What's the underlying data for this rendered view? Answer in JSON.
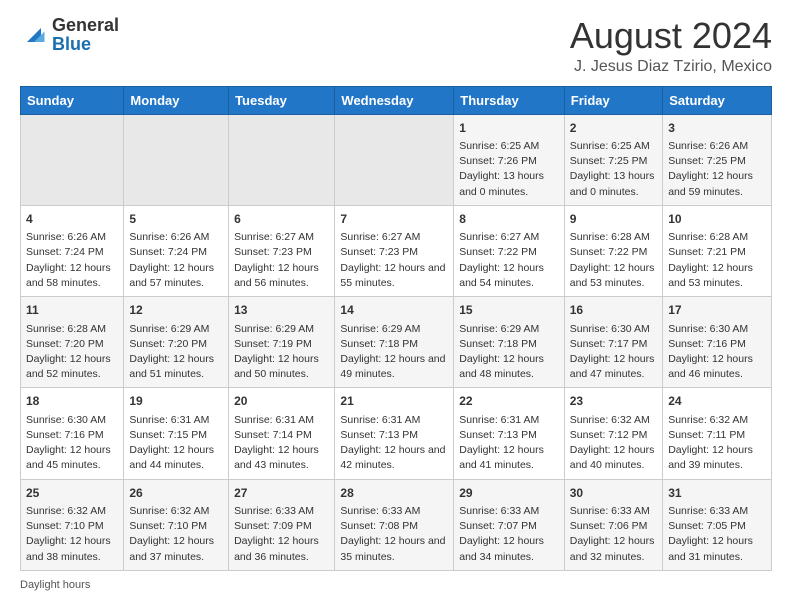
{
  "logo": {
    "general": "General",
    "blue": "Blue"
  },
  "title": "August 2024",
  "subtitle": "J. Jesus Diaz Tzirio, Mexico",
  "calendar": {
    "headers": [
      "Sunday",
      "Monday",
      "Tuesday",
      "Wednesday",
      "Thursday",
      "Friday",
      "Saturday"
    ],
    "weeks": [
      [
        {
          "day": "",
          "sunrise": "",
          "sunset": "",
          "daylight": "",
          "empty": true
        },
        {
          "day": "",
          "sunrise": "",
          "sunset": "",
          "daylight": "",
          "empty": true
        },
        {
          "day": "",
          "sunrise": "",
          "sunset": "",
          "daylight": "",
          "empty": true
        },
        {
          "day": "",
          "sunrise": "",
          "sunset": "",
          "daylight": "",
          "empty": true
        },
        {
          "day": "1",
          "sunrise": "Sunrise: 6:25 AM",
          "sunset": "Sunset: 7:26 PM",
          "daylight": "Daylight: 13 hours and 0 minutes."
        },
        {
          "day": "2",
          "sunrise": "Sunrise: 6:25 AM",
          "sunset": "Sunset: 7:25 PM",
          "daylight": "Daylight: 13 hours and 0 minutes."
        },
        {
          "day": "3",
          "sunrise": "Sunrise: 6:26 AM",
          "sunset": "Sunset: 7:25 PM",
          "daylight": "Daylight: 12 hours and 59 minutes."
        }
      ],
      [
        {
          "day": "4",
          "sunrise": "Sunrise: 6:26 AM",
          "sunset": "Sunset: 7:24 PM",
          "daylight": "Daylight: 12 hours and 58 minutes."
        },
        {
          "day": "5",
          "sunrise": "Sunrise: 6:26 AM",
          "sunset": "Sunset: 7:24 PM",
          "daylight": "Daylight: 12 hours and 57 minutes."
        },
        {
          "day": "6",
          "sunrise": "Sunrise: 6:27 AM",
          "sunset": "Sunset: 7:23 PM",
          "daylight": "Daylight: 12 hours and 56 minutes."
        },
        {
          "day": "7",
          "sunrise": "Sunrise: 6:27 AM",
          "sunset": "Sunset: 7:23 PM",
          "daylight": "Daylight: 12 hours and 55 minutes."
        },
        {
          "day": "8",
          "sunrise": "Sunrise: 6:27 AM",
          "sunset": "Sunset: 7:22 PM",
          "daylight": "Daylight: 12 hours and 54 minutes."
        },
        {
          "day": "9",
          "sunrise": "Sunrise: 6:28 AM",
          "sunset": "Sunset: 7:22 PM",
          "daylight": "Daylight: 12 hours and 53 minutes."
        },
        {
          "day": "10",
          "sunrise": "Sunrise: 6:28 AM",
          "sunset": "Sunset: 7:21 PM",
          "daylight": "Daylight: 12 hours and 53 minutes."
        }
      ],
      [
        {
          "day": "11",
          "sunrise": "Sunrise: 6:28 AM",
          "sunset": "Sunset: 7:20 PM",
          "daylight": "Daylight: 12 hours and 52 minutes."
        },
        {
          "day": "12",
          "sunrise": "Sunrise: 6:29 AM",
          "sunset": "Sunset: 7:20 PM",
          "daylight": "Daylight: 12 hours and 51 minutes."
        },
        {
          "day": "13",
          "sunrise": "Sunrise: 6:29 AM",
          "sunset": "Sunset: 7:19 PM",
          "daylight": "Daylight: 12 hours and 50 minutes."
        },
        {
          "day": "14",
          "sunrise": "Sunrise: 6:29 AM",
          "sunset": "Sunset: 7:18 PM",
          "daylight": "Daylight: 12 hours and 49 minutes."
        },
        {
          "day": "15",
          "sunrise": "Sunrise: 6:29 AM",
          "sunset": "Sunset: 7:18 PM",
          "daylight": "Daylight: 12 hours and 48 minutes."
        },
        {
          "day": "16",
          "sunrise": "Sunrise: 6:30 AM",
          "sunset": "Sunset: 7:17 PM",
          "daylight": "Daylight: 12 hours and 47 minutes."
        },
        {
          "day": "17",
          "sunrise": "Sunrise: 6:30 AM",
          "sunset": "Sunset: 7:16 PM",
          "daylight": "Daylight: 12 hours and 46 minutes."
        }
      ],
      [
        {
          "day": "18",
          "sunrise": "Sunrise: 6:30 AM",
          "sunset": "Sunset: 7:16 PM",
          "daylight": "Daylight: 12 hours and 45 minutes."
        },
        {
          "day": "19",
          "sunrise": "Sunrise: 6:31 AM",
          "sunset": "Sunset: 7:15 PM",
          "daylight": "Daylight: 12 hours and 44 minutes."
        },
        {
          "day": "20",
          "sunrise": "Sunrise: 6:31 AM",
          "sunset": "Sunset: 7:14 PM",
          "daylight": "Daylight: 12 hours and 43 minutes."
        },
        {
          "day": "21",
          "sunrise": "Sunrise: 6:31 AM",
          "sunset": "Sunset: 7:13 PM",
          "daylight": "Daylight: 12 hours and 42 minutes."
        },
        {
          "day": "22",
          "sunrise": "Sunrise: 6:31 AM",
          "sunset": "Sunset: 7:13 PM",
          "daylight": "Daylight: 12 hours and 41 minutes."
        },
        {
          "day": "23",
          "sunrise": "Sunrise: 6:32 AM",
          "sunset": "Sunset: 7:12 PM",
          "daylight": "Daylight: 12 hours and 40 minutes."
        },
        {
          "day": "24",
          "sunrise": "Sunrise: 6:32 AM",
          "sunset": "Sunset: 7:11 PM",
          "daylight": "Daylight: 12 hours and 39 minutes."
        }
      ],
      [
        {
          "day": "25",
          "sunrise": "Sunrise: 6:32 AM",
          "sunset": "Sunset: 7:10 PM",
          "daylight": "Daylight: 12 hours and 38 minutes."
        },
        {
          "day": "26",
          "sunrise": "Sunrise: 6:32 AM",
          "sunset": "Sunset: 7:10 PM",
          "daylight": "Daylight: 12 hours and 37 minutes."
        },
        {
          "day": "27",
          "sunrise": "Sunrise: 6:33 AM",
          "sunset": "Sunset: 7:09 PM",
          "daylight": "Daylight: 12 hours and 36 minutes."
        },
        {
          "day": "28",
          "sunrise": "Sunrise: 6:33 AM",
          "sunset": "Sunset: 7:08 PM",
          "daylight": "Daylight: 12 hours and 35 minutes."
        },
        {
          "day": "29",
          "sunrise": "Sunrise: 6:33 AM",
          "sunset": "Sunset: 7:07 PM",
          "daylight": "Daylight: 12 hours and 34 minutes."
        },
        {
          "day": "30",
          "sunrise": "Sunrise: 6:33 AM",
          "sunset": "Sunset: 7:06 PM",
          "daylight": "Daylight: 12 hours and 32 minutes."
        },
        {
          "day": "31",
          "sunrise": "Sunrise: 6:33 AM",
          "sunset": "Sunset: 7:05 PM",
          "daylight": "Daylight: 12 hours and 31 minutes."
        }
      ]
    ]
  },
  "footer": "Daylight hours"
}
